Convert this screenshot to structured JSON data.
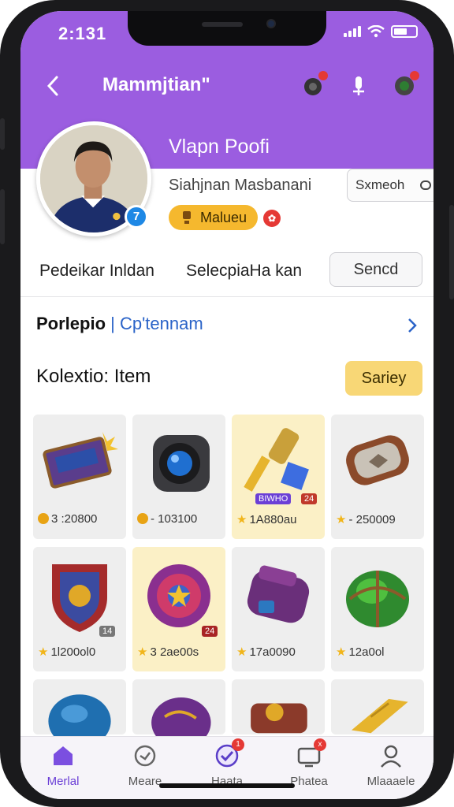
{
  "status_bar": {
    "time": "2:131"
  },
  "header": {
    "title": "Mammjtian\""
  },
  "profile": {
    "title": "Vlapn Poofi",
    "name": "Siahjnan Masbanani",
    "verified_badge": "7",
    "level_label": "Malueu",
    "share_label": "Sxmeoh"
  },
  "stats": {
    "left": "Pedeikar Inldan",
    "middle": "SelecpiaHa kan",
    "send_label": "Sencd"
  },
  "portfolio": {
    "label": "Porlepio",
    "link": "Cp'tennam"
  },
  "collection": {
    "title": "Kolextio: Item",
    "sort_label": "Sariey",
    "items": [
      {
        "price": "3 :20800",
        "currency": "coin",
        "icon": "treasure-chest-icon",
        "highlight": false
      },
      {
        "price": "- 103100",
        "currency": "coin",
        "icon": "lens-icon",
        "highlight": false
      },
      {
        "price": "1A880au",
        "currency": "star",
        "icon": "hammer-icon",
        "highlight": true,
        "tag": "BIWHO",
        "tag2": "24"
      },
      {
        "price": "- 250009",
        "currency": "star",
        "icon": "bracelet-icon",
        "highlight": false
      },
      {
        "price": "1l200ol0",
        "currency": "star",
        "icon": "shield-icon",
        "highlight": false,
        "tag": "14"
      },
      {
        "price": "3 2ae00s",
        "currency": "star",
        "icon": "amulet-icon",
        "highlight": true,
        "tag": "24"
      },
      {
        "price": "17a0090",
        "currency": "star",
        "icon": "pouch-icon",
        "highlight": false
      },
      {
        "price": "12a0ol",
        "currency": "star",
        "icon": "orb-icon",
        "highlight": false
      }
    ]
  },
  "bottom_nav": [
    {
      "label": "Merlal",
      "icon": "home-icon",
      "active": true
    },
    {
      "label": "Meare",
      "icon": "clock-icon",
      "active": false
    },
    {
      "label": "Haata",
      "icon": "check-badge-icon",
      "active": false,
      "badge": "1"
    },
    {
      "label": "Phatea",
      "icon": "tv-icon",
      "active": false,
      "badge": "x"
    },
    {
      "label": "Mlaaaele",
      "icon": "person-icon",
      "active": false
    }
  ]
}
